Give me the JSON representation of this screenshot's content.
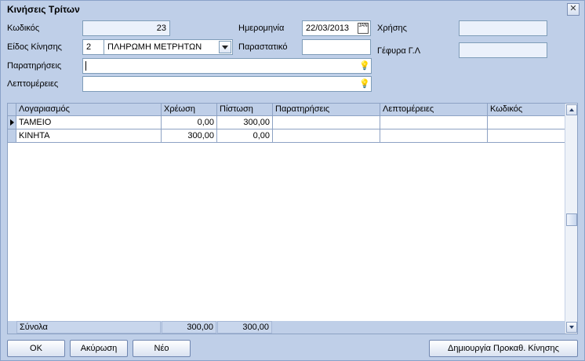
{
  "window": {
    "title": "Κινήσεις Τρίτων"
  },
  "form": {
    "code_label": "Κωδικός",
    "code_value": "23",
    "movement_type_label": "Είδος Κίνησης",
    "movement_type_code": "2",
    "movement_type_name": "ΠΛΗΡΩΜΗ ΜΕΤΡΗΤΩΝ",
    "notes_label": "Παρατηρήσεις",
    "notes_value": "",
    "details_label": "Λεπτομέρειες",
    "details_value": "",
    "date_label": "Ημερομηνία",
    "date_value": "22/03/2013",
    "document_label": "Παραστατικό",
    "document_value": "",
    "fiscal_year_label": "Χρήσης",
    "fiscal_year_value": "",
    "gl_bridge_label": "Γέφυρα Γ.Λ",
    "gl_bridge_value": "",
    "calendar_icon_text": "JAN"
  },
  "grid": {
    "columns": [
      "Λογαριασμός",
      "Χρέωση",
      "Πίστωση",
      "Παρατηρήσεις",
      "Λεπτομέρειες",
      "Κωδικός"
    ],
    "rows": [
      {
        "account": "ΤΑΜΕΙΟ",
        "debit": "0,00",
        "credit": "300,00",
        "notes": "",
        "details": "",
        "code": ""
      },
      {
        "account": "ΚΙΝΗΤΑ",
        "debit": "300,00",
        "credit": "0,00",
        "notes": "",
        "details": "",
        "code": ""
      }
    ],
    "totals": {
      "label": "Σύνολα",
      "debit": "300,00",
      "credit": "300,00"
    }
  },
  "buttons": {
    "ok": "OK",
    "cancel": "Ακύρωση",
    "new": "Νέο",
    "create_preset": "Δημιουργία Προκαθ. Κίνησης",
    "close": "✕"
  }
}
